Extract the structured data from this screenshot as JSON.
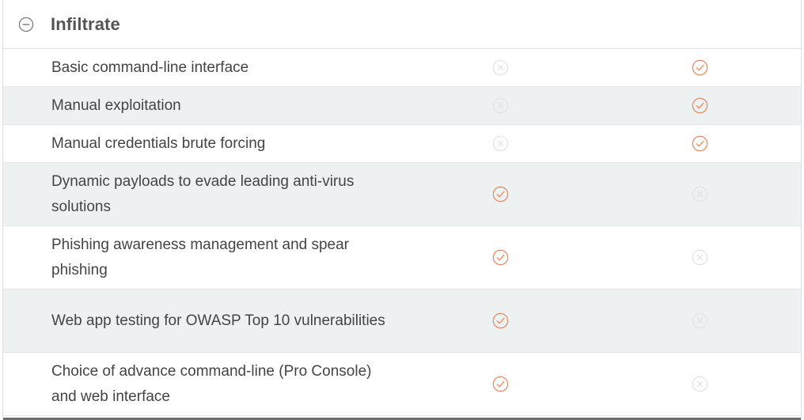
{
  "section": {
    "title": "Infiltrate",
    "toggle_icon": "minus-circle-icon",
    "colors": {
      "title": "#555555",
      "check": "#e8906a",
      "cross": "#e1e3e5",
      "alt_row": "#eef1f2"
    }
  },
  "rows": [
    {
      "label": "Basic command-line interface",
      "col1": "cross-icon",
      "col2": "check-icon"
    },
    {
      "label": "Manual exploitation",
      "col1": "cross-icon",
      "col2": "check-icon"
    },
    {
      "label": "Manual credentials brute forcing",
      "col1": "cross-icon",
      "col2": "check-icon"
    },
    {
      "label": "Dynamic payloads to evade leading anti-virus solutions",
      "col1": "check-icon",
      "col2": "cross-icon"
    },
    {
      "label": "Phishing awareness management and spear phishing",
      "col1": "check-icon",
      "col2": "cross-icon"
    },
    {
      "label": "Web app testing for OWASP Top 10 vulnerabilities",
      "col1": "check-icon",
      "col2": "cross-icon"
    },
    {
      "label": "Choice of advance command-line (Pro Console) and web interface",
      "col1": "check-icon",
      "col2": "cross-icon"
    }
  ]
}
